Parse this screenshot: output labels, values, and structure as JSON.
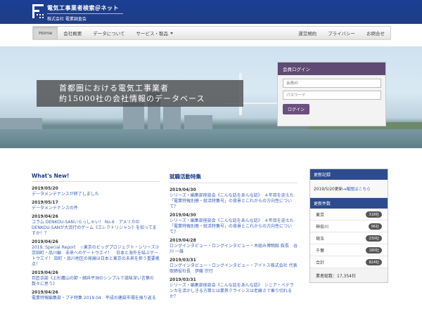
{
  "header": {
    "logo_line1": "電気工事業者検索＠ネット",
    "logo_line2": "株式会社 電業調査会"
  },
  "nav": {
    "items": [
      {
        "label": "Home",
        "active": true
      },
      {
        "label": "会社概要"
      },
      {
        "label": "データについて"
      },
      {
        "label": "サービス・製品",
        "dropdown": true
      }
    ],
    "right_items": [
      {
        "label": "運営規約"
      },
      {
        "label": "プライバシー"
      },
      {
        "label": "お問合せ"
      }
    ]
  },
  "hero": {
    "line1": "首都圏における電気工事業者",
    "line2": "約15000社の会社情報のデータベース"
  },
  "login": {
    "title": "会員ログイン",
    "id_placeholder": "会員ID",
    "pw_placeholder": "パスワード",
    "button": "ログイン"
  },
  "news": {
    "title": "What's New!",
    "items": [
      {
        "date": "2019/05/20",
        "text": "データメンテナンスが終了しました"
      },
      {
        "date": "2019/05/17",
        "text": "データメンテナンスの件"
      },
      {
        "date": "2019/04/26",
        "text": "コラム DENKOU-SANいらっしゃい！ No.6　アメリカの DENKOU-SANが大流行のゲーム《エレクトリシャン》を知ってますか！？"
      },
      {
        "date": "2019/04/26",
        "text": "2019, Special Report　☆東京のビッグプロジェクト・シリーズ⑦ 京田町・品川編　未来へのゲートウエイ！　日本と海外を結ぶゲートウエイ！ 田町・品川地区の発展は日本と東京の未来を担う重要拠点！"
      },
      {
        "date": "2019/04/26",
        "text": "巨匠余談《上杉鷹山の節・細井平洲のシンプルで滋味深い言葉の数々に思う》"
      },
      {
        "date": "2019/04/26",
        "text": "電業特報編集部・ブチ特集 2019.04　平成の建設市場を振り返る"
      }
    ]
  },
  "jobs": {
    "title": "就職活動特集",
    "items": [
      {
        "date": "2019/04/30",
        "text": "シリーズ・編集部座談会《こんな話をあんな話》　４年目を迎えた「電業特報別冊・就活特集号」の背景とこれからの方向性について？"
      },
      {
        "date": "2019/04/30",
        "text": "シリーズ・編集部座談会《こんな話をあんな話》　４年目を迎えた「電業特報別冊・就活特集号」の背景とこれからの方向性について？"
      },
      {
        "date": "2019/04/28",
        "text": "ロングインタビュー・ロングインタビュー・木組み博物館 館長　谷川 一雄"
      },
      {
        "date": "2019/03/31",
        "text": "ロングインタビュー・ロングインタビュー・アイトス株式会社 代表取締役社長　伊藤 宗行"
      },
      {
        "date": "2019/03/31",
        "text": "シリーズ・編集部座談会《こんな話をあんな話》　シニア・ベテランカを活かしきる方策とは業界クライシスは老練さで乗り切れるか？"
      }
    ]
  },
  "sidebar": {
    "update_title": "更新記録",
    "update_text": "2019/5/20更新→",
    "update_link": "履歴はこちら",
    "count_title": "更新件数",
    "rows": [
      {
        "label": "東京",
        "count": "318社"
      },
      {
        "label": "神奈川",
        "count": "96社"
      },
      {
        "label": "埼玉",
        "count": "230社"
      },
      {
        "label": "千葉",
        "count": "180社"
      },
      {
        "label": "合計",
        "count": "824社"
      }
    ],
    "total_label": "業者総数：17,354社"
  }
}
